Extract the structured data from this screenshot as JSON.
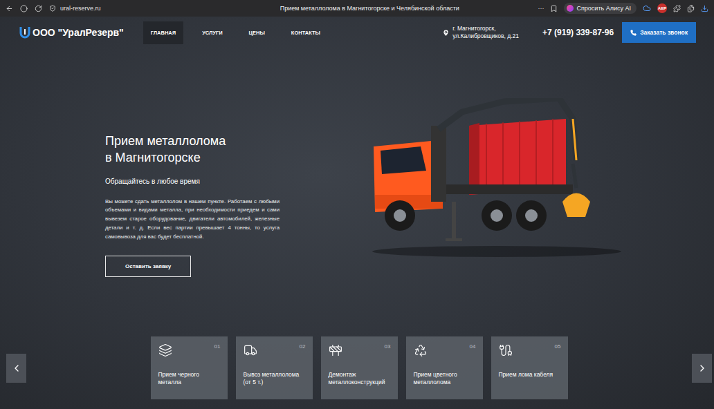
{
  "browser": {
    "url": "ural-reserve.ru",
    "title": "Прием металлолома в Магнитогорске и Челябинской области",
    "menu": "···",
    "assistant": "Спросить Алису AI",
    "badge": "ABP"
  },
  "site": {
    "logo": "ООО \"УралРезерв\"",
    "nav": [
      {
        "label": "ГЛАВНАЯ",
        "selected": true
      },
      {
        "label": "УСЛУГИ",
        "selected": false
      },
      {
        "label": "ЦЕНЫ",
        "selected": false
      },
      {
        "label": "КОНТАКТЫ",
        "selected": false
      }
    ],
    "address_lines": [
      "г. Магнитогорск,",
      "ул.Калибровщиков, д.21"
    ],
    "phone": "+7 (919) 339-87-96",
    "call_button": "Заказать звонок"
  },
  "hero": {
    "title_lines": [
      "Прием металлолома",
      "в Магнитогорске"
    ],
    "subtitle": "Обращайтесь в любое время",
    "text": "Вы можете сдать металлолом в нашем пункте. Работаем с любыми объемами и видами металла, при необходимости приедем и сами вывезем старое оборудование, двигатели автомобилей, железные детали и т. д. Если вес партии превышает 4 тонны, то услуга самовывоза для вас будет бесплатной.",
    "button": "Оставить заявку"
  },
  "services": [
    {
      "number": "01",
      "label": "Прием черного металла"
    },
    {
      "number": "02",
      "label": "Вывоз металлолома (от 5 т.)"
    },
    {
      "number": "03",
      "label": "Демонтаж металлоконструкций"
    },
    {
      "number": "04",
      "label": "Прием цветного металлолома"
    },
    {
      "number": "05",
      "label": "Прием лома кабеля"
    }
  ]
}
